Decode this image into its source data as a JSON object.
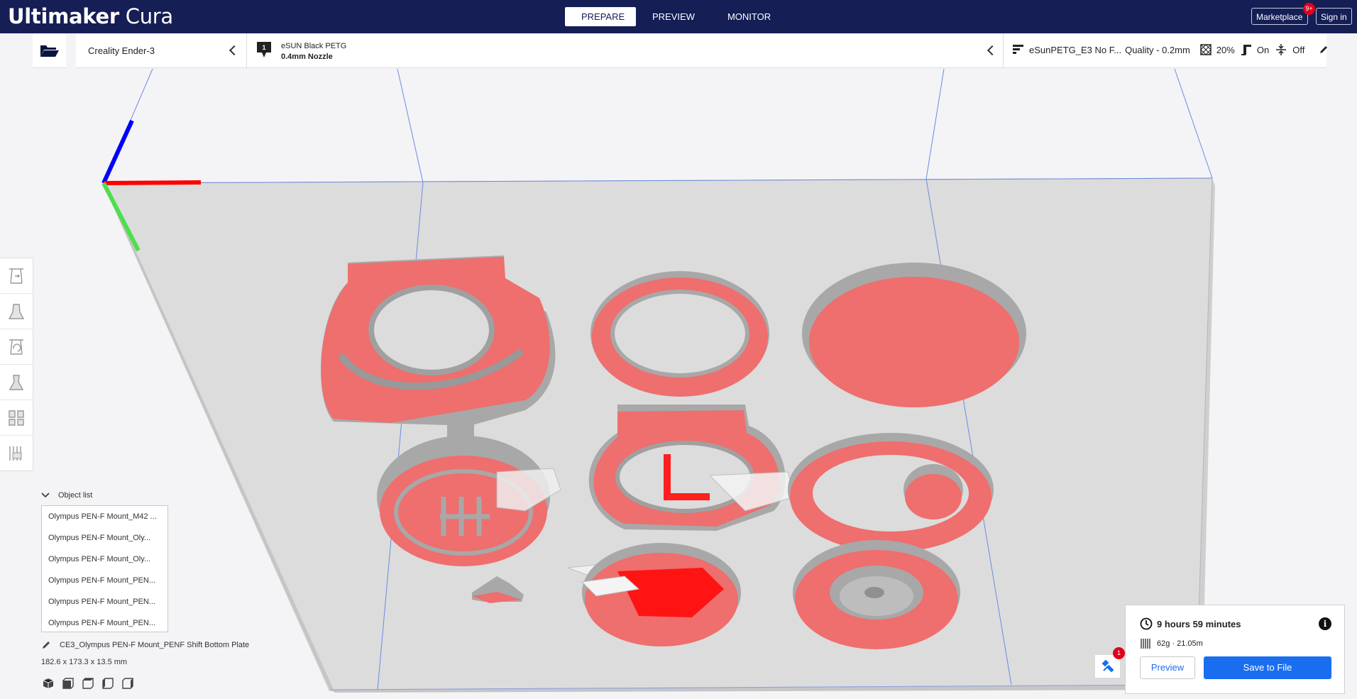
{
  "app": {
    "brand_bold": "Ultimaker",
    "brand_light": " Cura"
  },
  "tabs": [
    {
      "label": "PREPARE"
    },
    {
      "label": "PREVIEW"
    },
    {
      "label": "MONITOR"
    }
  ],
  "header": {
    "marketplace": "Marketplace",
    "marketplace_badge": "9+",
    "signin": "Sign in"
  },
  "printer": {
    "name": "Creality Ender-3"
  },
  "material": {
    "name": "eSUN Black PETG",
    "nozzle": "0.4mm Nozzle"
  },
  "settings": {
    "profile": "eSunPETG_E3 No F...",
    "quality": "Quality - 0.2mm",
    "infill": "20%",
    "support": "On",
    "adhesion": "Off"
  },
  "tools": [
    {
      "icon": "move-icon"
    },
    {
      "icon": "scale-icon"
    },
    {
      "icon": "rotate-icon"
    },
    {
      "icon": "mirror-icon"
    },
    {
      "icon": "per-model-settings-icon"
    },
    {
      "icon": "support-blocker-icon"
    }
  ],
  "object_list": {
    "title": "Object list",
    "items": [
      "Olympus PEN-F Mount_M42 ...",
      "Olympus PEN-F Mount_Oly...",
      "Olympus PEN-F Mount_Oly...",
      "Olympus PEN-F Mount_PEN...",
      "Olympus PEN-F Mount_PEN...",
      "Olympus PEN-F Mount_PEN..."
    ],
    "selected_name": "CE3_Olympus PEN-F Mount_PENF Shift Bottom Plate",
    "dimensions": "182.6 x 173.3 x 13.5 mm"
  },
  "print": {
    "time": "9 hours 59 minutes",
    "material": "62g · 21.05m",
    "preview_label": "Preview",
    "save_label": "Save to File",
    "plugin_badge": "1"
  },
  "colors": {
    "topbar": "#151e55",
    "accent": "#196ef0",
    "model": "#ef6e6e",
    "overhang": "#ff0000"
  }
}
